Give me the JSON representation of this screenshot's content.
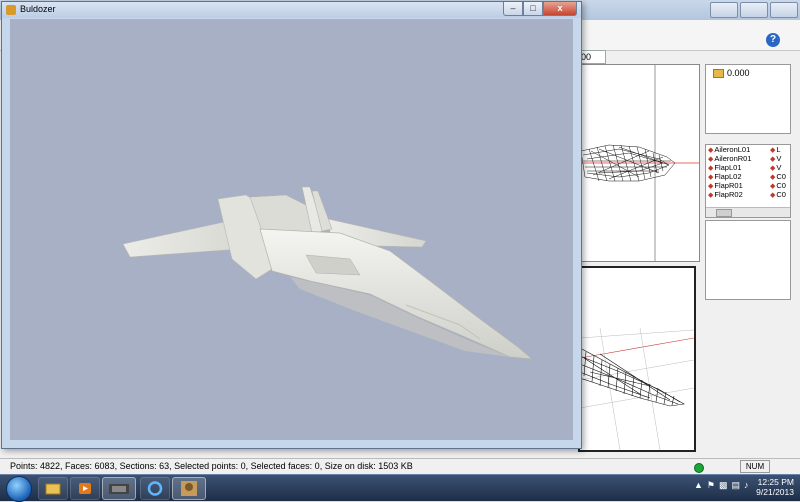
{
  "buldozer_window": {
    "title": "Buldozer",
    "controls": {
      "minimize": "–",
      "maximize": "□",
      "close": "x"
    },
    "viewport_bg": "#a7b0c5"
  },
  "editor": {
    "help_icon": "help-icon",
    "field_value": "00",
    "props_value": "0.000",
    "selection_list": [
      {
        "left": "AileronL01",
        "right": "L"
      },
      {
        "left": "AileronR01",
        "right": "V"
      },
      {
        "left": "FlapL01",
        "right": "V"
      },
      {
        "left": "FlapL02",
        "right": "C0"
      },
      {
        "left": "FlapR01",
        "right": "C0"
      },
      {
        "left": "FlapR02",
        "right": "C0"
      }
    ],
    "status_text": "Points: 4822, Faces: 6083, Sections: 63, Selected points: 0, Selected faces: 0, Size on disk: 1503 KB",
    "num_indicator": "NUM",
    "status_led_color": "#1ea53a"
  },
  "taskbar": {
    "start": "start-button",
    "clock_time": "12:25 PM",
    "clock_date": "9/21/2013"
  }
}
